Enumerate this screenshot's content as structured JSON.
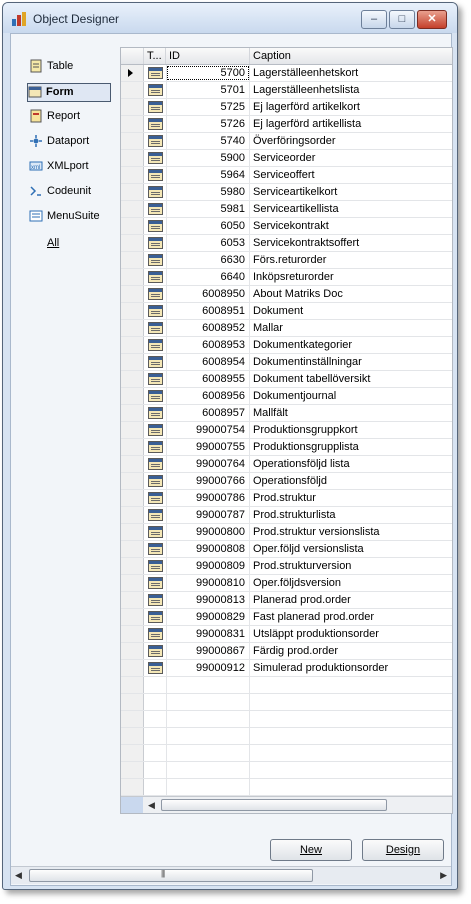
{
  "window": {
    "title": "Object Designer"
  },
  "sidebar": {
    "items": [
      {
        "label": "Table",
        "icon": "table-icon"
      },
      {
        "label": "Form",
        "icon": "form-icon",
        "active": true
      },
      {
        "label": "Report",
        "icon": "report-icon"
      },
      {
        "label": "Dataport",
        "icon": "dataport-icon"
      },
      {
        "label": "XMLport",
        "icon": "xmlport-icon"
      },
      {
        "label": "Codeunit",
        "icon": "codeunit-icon"
      },
      {
        "label": "MenuSuite",
        "icon": "menusuite-icon"
      }
    ],
    "all_label": "All"
  },
  "grid": {
    "columns": {
      "type": "T...",
      "id": "ID",
      "caption": "Caption"
    },
    "rows": [
      {
        "id": "5700",
        "caption": "Lagerställeenhetskort"
      },
      {
        "id": "5701",
        "caption": "Lagerställeenhetslista"
      },
      {
        "id": "5725",
        "caption": "Ej lagerförd artikelkort"
      },
      {
        "id": "5726",
        "caption": "Ej lagerförd artikellista"
      },
      {
        "id": "5740",
        "caption": "Överföringsorder"
      },
      {
        "id": "5900",
        "caption": "Serviceorder"
      },
      {
        "id": "5964",
        "caption": "Serviceoffert"
      },
      {
        "id": "5980",
        "caption": "Serviceartikelkort"
      },
      {
        "id": "5981",
        "caption": "Serviceartikellista"
      },
      {
        "id": "6050",
        "caption": "Servicekontrakt"
      },
      {
        "id": "6053",
        "caption": "Servicekontraktsoffert"
      },
      {
        "id": "6630",
        "caption": "Förs.returorder"
      },
      {
        "id": "6640",
        "caption": "Inköpsreturorder"
      },
      {
        "id": "6008950",
        "caption": "About Matriks Doc"
      },
      {
        "id": "6008951",
        "caption": "Dokument"
      },
      {
        "id": "6008952",
        "caption": "Mallar"
      },
      {
        "id": "6008953",
        "caption": "Dokumentkategorier"
      },
      {
        "id": "6008954",
        "caption": "Dokumentinställningar"
      },
      {
        "id": "6008955",
        "caption": "Dokument tabellöversikt"
      },
      {
        "id": "6008956",
        "caption": "Dokumentjournal"
      },
      {
        "id": "6008957",
        "caption": "Mallfält"
      },
      {
        "id": "99000754",
        "caption": "Produktionsgruppkort"
      },
      {
        "id": "99000755",
        "caption": "Produktionsgrupplista"
      },
      {
        "id": "99000764",
        "caption": "Operationsföljd lista"
      },
      {
        "id": "99000766",
        "caption": "Operationsföljd"
      },
      {
        "id": "99000786",
        "caption": "Prod.struktur"
      },
      {
        "id": "99000787",
        "caption": "Prod.strukturlista"
      },
      {
        "id": "99000800",
        "caption": "Prod.struktur versionslista"
      },
      {
        "id": "99000808",
        "caption": "Oper.följd versionslista"
      },
      {
        "id": "99000809",
        "caption": "Prod.strukturversion"
      },
      {
        "id": "99000810",
        "caption": "Oper.följdsversion"
      },
      {
        "id": "99000813",
        "caption": "Planerad prod.order"
      },
      {
        "id": "99000829",
        "caption": "Fast planerad prod.order"
      },
      {
        "id": "99000831",
        "caption": "Utsläppt produktionsorder"
      },
      {
        "id": "99000867",
        "caption": "Färdig prod.order"
      },
      {
        "id": "99000912",
        "caption": "Simulerad produktionsorder"
      }
    ]
  },
  "buttons": {
    "new": "New",
    "design": "Design"
  }
}
